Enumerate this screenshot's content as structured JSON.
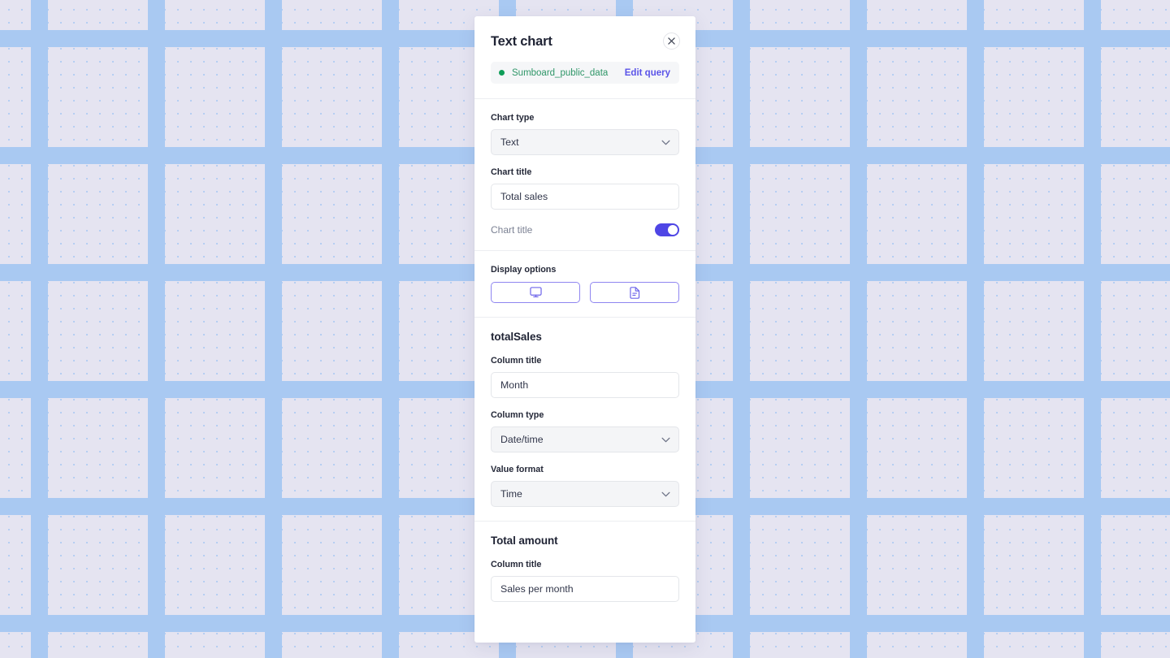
{
  "header": {
    "title": "Text chart",
    "close_icon": "close-icon",
    "source": {
      "status_dot": "status-dot-green",
      "name": "Sumboard_public_data",
      "edit_query_label": "Edit query"
    }
  },
  "chart_settings": {
    "chart_type": {
      "label": "Chart type",
      "value": "Text",
      "chevron_icon": "chevron-down-icon"
    },
    "chart_title": {
      "label": "Chart title",
      "value": "Total sales",
      "placeholder": "Chart title"
    },
    "chart_title_toggle": {
      "label": "Chart title",
      "state": "on"
    },
    "display_options": {
      "label": "Display options",
      "buttons": [
        {
          "icon": "monitor-icon",
          "selected": true
        },
        {
          "icon": "document-icon",
          "selected": false
        }
      ]
    }
  },
  "column_sections": [
    {
      "heading": "totalSales",
      "fields": [
        {
          "kind": "input",
          "label": "Column title",
          "value": "Month",
          "placeholder": "Column title"
        },
        {
          "kind": "select",
          "label": "Column type",
          "value": "Date/time",
          "chevron_icon": "chevron-down-icon"
        },
        {
          "kind": "select",
          "label": "Value format",
          "value": "Time",
          "chevron_icon": "chevron-down-icon"
        }
      ]
    },
    {
      "heading": "Total amount",
      "fields": [
        {
          "kind": "input",
          "label": "Column title",
          "value": "Sales per month",
          "placeholder": "Column title"
        }
      ]
    }
  ],
  "colors": {
    "accent_purple": "#5b54e8",
    "toggle_on": "#4f46e5",
    "source_green": "#2f9668",
    "canvas": "#e5e4f1",
    "grid_dot": "#a9c9f2"
  }
}
